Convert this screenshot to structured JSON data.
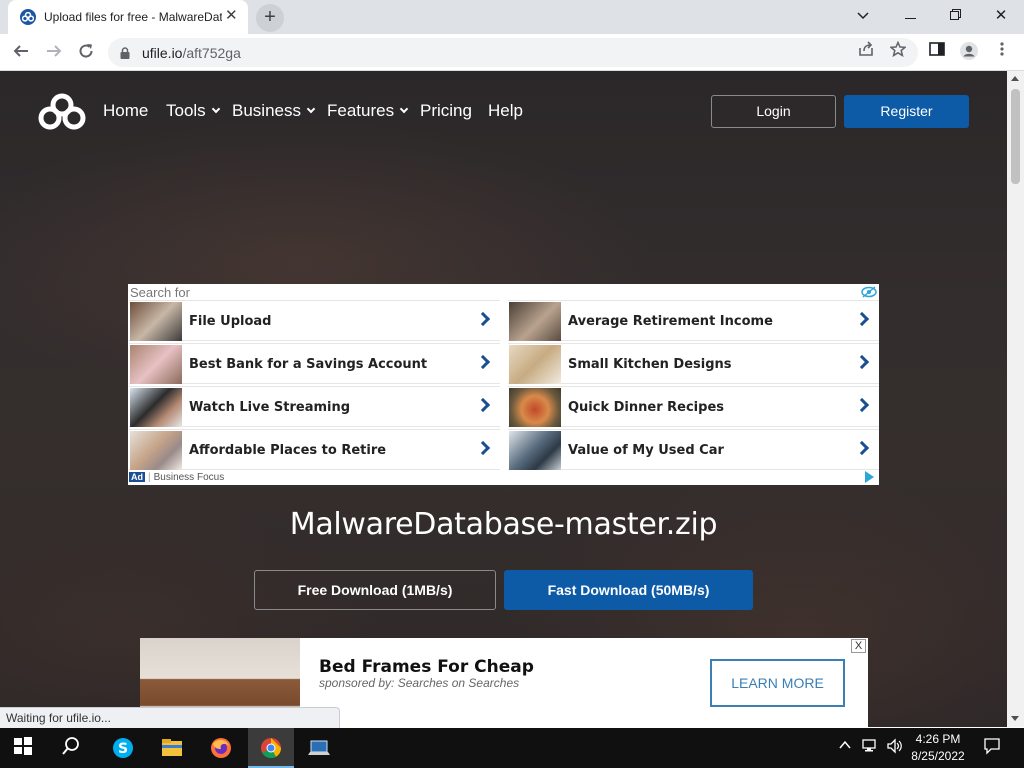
{
  "browser": {
    "tab_title": "Upload files for free - MalwareDatabase",
    "url_host": "ufile.io",
    "url_path": "/aft752ga"
  },
  "site": {
    "nav": [
      {
        "label": "Home",
        "has_menu": false
      },
      {
        "label": "Tools",
        "has_menu": true
      },
      {
        "label": "Business",
        "has_menu": true
      },
      {
        "label": "Features",
        "has_menu": true
      },
      {
        "label": "Pricing",
        "has_menu": false
      },
      {
        "label": "Help",
        "has_menu": false
      }
    ],
    "login_label": "Login",
    "register_label": "Register"
  },
  "ad1": {
    "search_for": "Search for",
    "items": [
      "File Upload",
      "Average Retirement Income",
      "Best Bank for a Savings Account",
      "Small Kitchen Designs",
      "Watch Live Streaming",
      "Quick Dinner Recipes",
      "Affordable Places to Retire",
      "Value of My Used Car"
    ],
    "ad_tag": "Ad",
    "advertiser": "Business Focus"
  },
  "file": {
    "name": "MalwareDatabase-master.zip",
    "free_download_label": "Free Download (1MB/s)",
    "fast_download_label": "Fast Download (50MB/s)"
  },
  "ad2": {
    "headline": "Bed Frames For Cheap",
    "sponsor": "sponsored by: Searches on Searches",
    "cta": "LEARN MORE",
    "close": "X"
  },
  "status_text": "Waiting for ufile.io...",
  "taskbar": {
    "time": "4:26 PM",
    "date": "8/25/2022"
  },
  "colors": {
    "accent_blue": "#0d5aa7",
    "page_bg": "#2f2a2a",
    "ad_chevron": "#1b4f91"
  }
}
